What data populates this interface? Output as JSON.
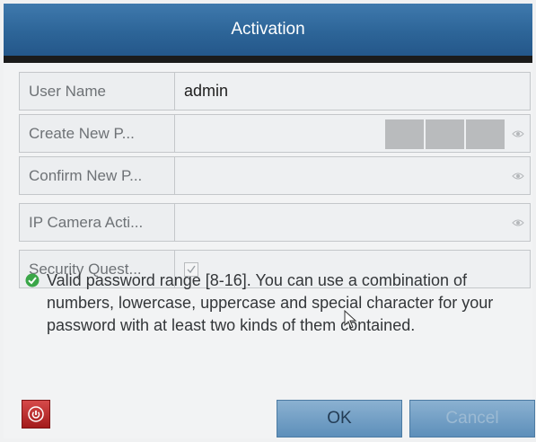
{
  "dialog": {
    "title": "Activation"
  },
  "fields": [
    {
      "label": "User Name",
      "value": "admin",
      "type": "text"
    },
    {
      "label": "Create New P...",
      "value": "",
      "type": "password",
      "strength_segments": 3
    },
    {
      "label": "Confirm New P...",
      "value": "",
      "type": "password"
    },
    {
      "label": "IP Camera Acti...",
      "value": "",
      "type": "password"
    },
    {
      "label": "Security Quest...",
      "checked": true,
      "type": "checkbox"
    }
  ],
  "hint": {
    "text": "Valid password range [8-16]. You can use a combination of numbers, lowercase, uppercase and special character for your password with at least two kinds of them contained."
  },
  "buttons": {
    "ok": "OK",
    "cancel": "Cancel"
  },
  "colors": {
    "title_bar": "#2d6598",
    "button": "#6f9cc4",
    "power_button": "#c03030",
    "valid_icon": "#3aa648"
  },
  "icons": [
    "eye-icon",
    "check-circle-icon",
    "power-icon",
    "checkmark-icon",
    "cursor-icon"
  ]
}
